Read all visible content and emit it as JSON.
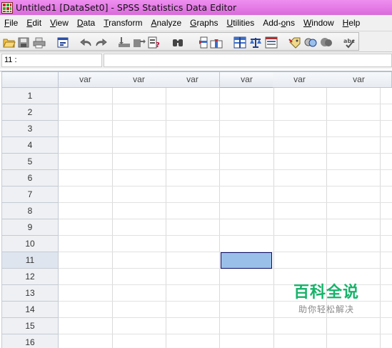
{
  "window": {
    "title": "Untitled1 [DataSet0] - SPSS Statistics Data Editor",
    "icon": "spss-app-icon"
  },
  "menu": [
    {
      "key": "F",
      "rest": "ile"
    },
    {
      "key": "E",
      "rest": "dit"
    },
    {
      "key": "V",
      "rest": "iew"
    },
    {
      "key": "D",
      "rest": "ata"
    },
    {
      "key": "T",
      "rest": "ransform"
    },
    {
      "key": "A",
      "rest": "nalyze"
    },
    {
      "key": "G",
      "rest": "raphs"
    },
    {
      "key": "U",
      "rest": "tilities"
    },
    {
      "pre": "Add-",
      "key": "o",
      "rest": "ns"
    },
    {
      "key": "W",
      "rest": "indow"
    },
    {
      "key": "H",
      "rest": "elp"
    }
  ],
  "toolbar": {
    "icons": [
      "open-icon",
      "save-icon",
      "print-icon",
      "dialog-recall-icon",
      "undo-icon",
      "redo-icon",
      "goto-case-icon",
      "goto-variable-icon",
      "variables-icon",
      "find-icon",
      "insert-cases-icon",
      "insert-variable-icon",
      "split-file-icon",
      "weight-cases-icon",
      "select-cases-icon",
      "value-labels-icon",
      "use-sets-icon",
      "show-all-variables-icon",
      "spelling-icon"
    ]
  },
  "cell_editor": {
    "reference": "11 :",
    "value": ""
  },
  "grid": {
    "columns": [
      "var",
      "var",
      "var",
      "var",
      "var",
      "var"
    ],
    "rows": [
      "1",
      "2",
      "3",
      "4",
      "5",
      "6",
      "7",
      "8",
      "9",
      "10",
      "11",
      "12",
      "13",
      "14",
      "15",
      "16"
    ],
    "selected_row": "11",
    "selected_column_index": 4
  },
  "watermark": {
    "title": "百科全说",
    "subtitle": "助你轻松解决"
  }
}
